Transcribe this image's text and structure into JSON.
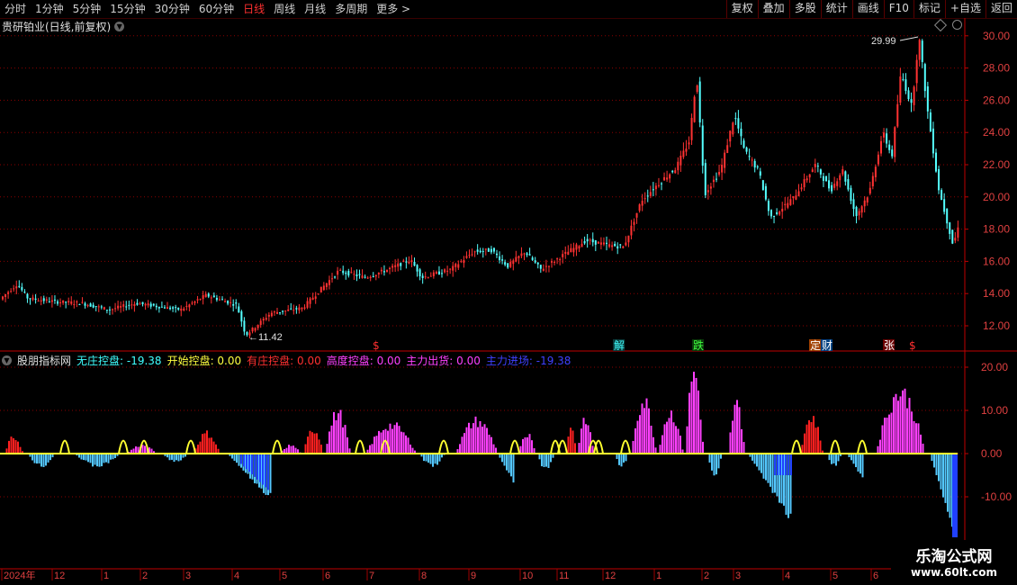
{
  "toolbar": {
    "periods": [
      "分时",
      "1分钟",
      "5分钟",
      "15分钟",
      "30分钟",
      "60分钟",
      "日线",
      "周线",
      "月线",
      "多周期",
      "更多 >"
    ],
    "active_period": "日线",
    "tools": [
      "复权",
      "叠加",
      "多股",
      "统计",
      "画线",
      "F10",
      "标记",
      "+自选",
      "返回"
    ]
  },
  "stock": {
    "title": "贵研铂业(日线,前复权)",
    "high_label": "29.99",
    "low_label": "11.42",
    "price_axis": [
      "30.00",
      "28.00",
      "26.00",
      "24.00",
      "22.00",
      "20.00",
      "18.00",
      "16.00",
      "14.00",
      "12.00"
    ]
  },
  "markers": [
    {
      "text": "$",
      "color": "#ff3030"
    },
    {
      "text": "解",
      "color": "#40ffff",
      "bg": "#0a3a3a"
    },
    {
      "text": "跌",
      "color": "#40ff40",
      "bg": "#0a3a0a"
    },
    {
      "text": "定",
      "color": "#ffffff",
      "bg": "#a04000"
    },
    {
      "text": "财",
      "color": "#ffffff",
      "bg": "#004080"
    },
    {
      "text": "张",
      "color": "#ffffff",
      "bg": "#6a0000"
    },
    {
      "text": "$",
      "color": "#ff3030"
    }
  ],
  "indicator": {
    "name": "股朋指标网",
    "items": [
      {
        "label": "无庄控盘:",
        "value": "-19.38",
        "color": "#40ffff"
      },
      {
        "label": "开始控盘:",
        "value": "0.00",
        "color": "#ffff40"
      },
      {
        "label": "有庄控盘:",
        "value": "0.00",
        "color": "#ff3030"
      },
      {
        "label": "高度控盘:",
        "value": "0.00",
        "color": "#ff40ff"
      },
      {
        "label": "主力出货:",
        "value": "0.00",
        "color": "#ff40ff"
      },
      {
        "label": "主力进场:",
        "value": "-19.38",
        "color": "#4040ff"
      }
    ],
    "axis": [
      "20.00",
      "10.00",
      "0.00",
      "-10.00"
    ]
  },
  "date_axis": [
    "2024年",
    "12",
    "1",
    "2",
    "3",
    "4",
    "5",
    "6",
    "7",
    "8",
    "9",
    "10",
    "11",
    "12",
    "1",
    "2",
    "3",
    "4",
    "5",
    "6"
  ],
  "watermark": {
    "line1": "乐淘公式网",
    "line2": "www.60lt.com"
  },
  "colors": {
    "up": "#ff3232",
    "down": "#54ffff",
    "grid": "#8a0000",
    "axis": "#c00000"
  }
}
